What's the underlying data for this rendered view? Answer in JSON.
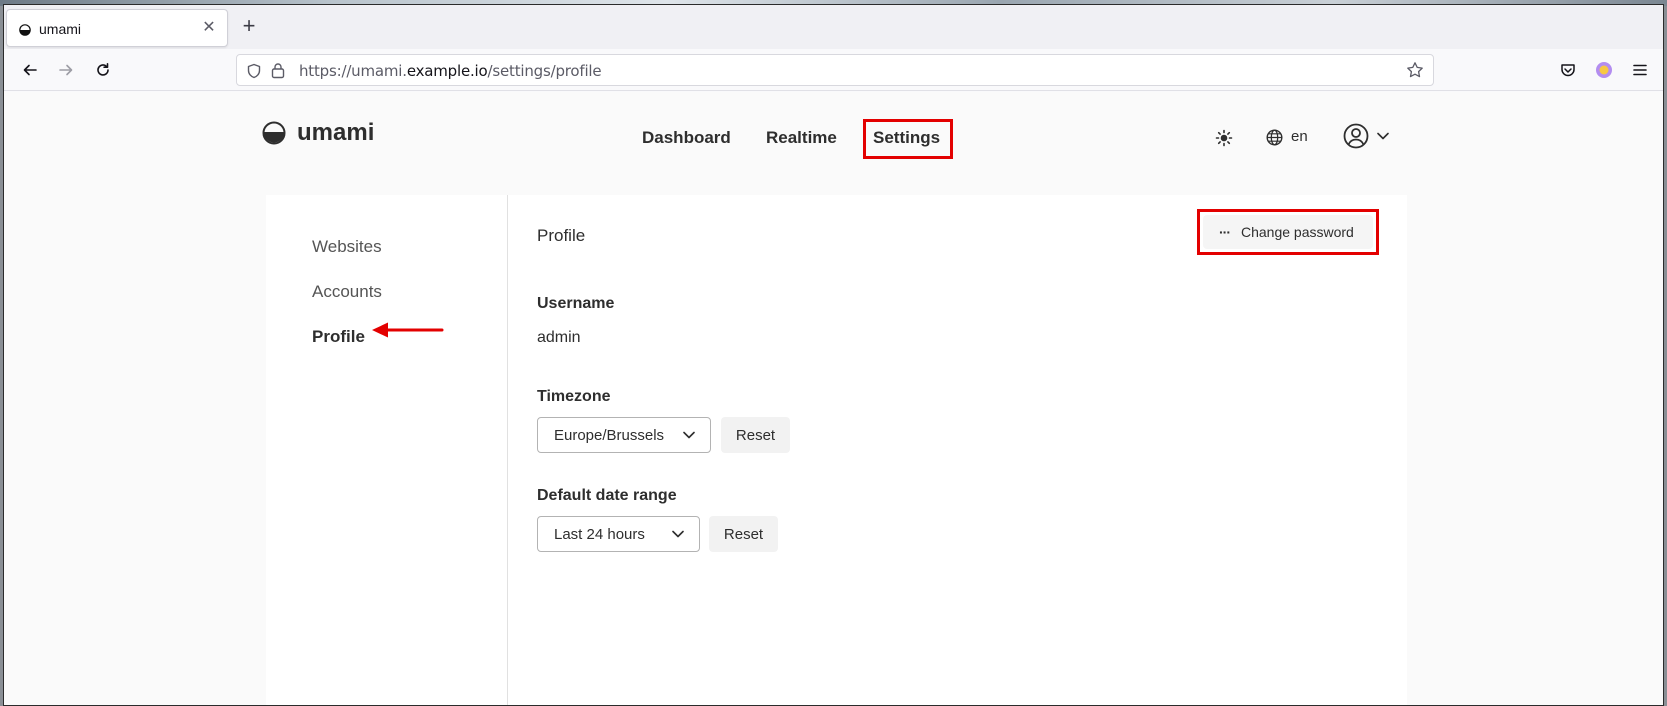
{
  "browser": {
    "tab": {
      "title": "umami",
      "favicon": "umami-logo-icon"
    },
    "url": {
      "prefix": "https://umami.",
      "host": "example.io",
      "path": "/settings/profile"
    }
  },
  "app": {
    "logo_text": "umami",
    "nav": {
      "dashboard": "Dashboard",
      "realtime": "Realtime",
      "settings": "Settings"
    },
    "language": "en"
  },
  "sidebar": {
    "items": [
      {
        "label": "Websites"
      },
      {
        "label": "Accounts"
      },
      {
        "label": "Profile"
      }
    ]
  },
  "profile": {
    "section_title": "Profile",
    "change_password_label": "Change password",
    "change_password_dots": "···",
    "username_label": "Username",
    "username_value": "admin",
    "timezone_label": "Timezone",
    "timezone_value": "Europe/Brussels",
    "timezone_reset": "Reset",
    "date_range_label": "Default date range",
    "date_range_value": "Last 24 hours",
    "date_range_reset": "Reset"
  },
  "annotations": {
    "highlight_color": "#e30000"
  }
}
